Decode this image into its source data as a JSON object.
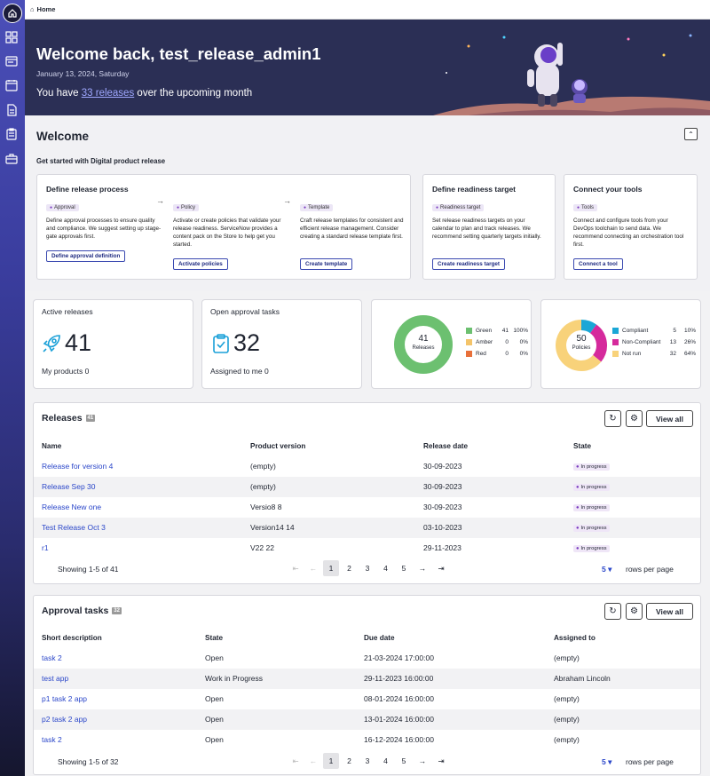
{
  "breadcrumb": {
    "home": "Home"
  },
  "hero": {
    "title": "Welcome back, test_release_admin1",
    "date": "January 13, 2024, Saturday",
    "msg_pre": "You have",
    "msg_link": "33 releases",
    "msg_post": "over the upcoming month"
  },
  "welcome": {
    "title": "Welcome",
    "subtitle": "Get started with Digital product release",
    "process": {
      "title": "Define release process",
      "steps": [
        {
          "pill": "Approval",
          "desc": "Define approval processes to ensure quality and compliance. We suggest setting up stage-gate approvals first.",
          "button": "Define approval definition"
        },
        {
          "pill": "Policy",
          "desc": "Activate or create policies that validate your release readiness. ServiceNow provides a content pack on the Store to help get you started.",
          "button": "Activate policies"
        },
        {
          "pill": "Template",
          "desc": "Craft release templates for consistent and efficient release management. Consider creating a standard release template first.",
          "button": "Create template"
        }
      ]
    },
    "readiness": {
      "title": "Define readiness target",
      "pill": "Readiness target",
      "desc": "Set release readiness targets on your calendar to plan and track releases. We recommend setting quarterly targets initially.",
      "button": "Create readiness target"
    },
    "tools": {
      "title": "Connect your tools",
      "pill": "Tools",
      "desc": "Connect and configure tools from your DevOps toolchain to send data. We recommend connecting an orchestration tool first.",
      "button": "Connect a tool"
    }
  },
  "stats": {
    "active": {
      "title": "Active releases",
      "value": "41",
      "sub": "My products 0"
    },
    "approvals": {
      "title": "Open approval tasks",
      "value": "32",
      "sub": "Assigned to me 0"
    }
  },
  "chart_data": [
    {
      "type": "pie",
      "center_value": "41",
      "center_label": "Releases",
      "categories": [
        "Green",
        "Amber",
        "Red"
      ],
      "values": [
        41,
        0,
        0
      ],
      "percents": [
        "100%",
        "0%",
        "0%"
      ],
      "colors": [
        "#6cc070",
        "#f4c46a",
        "#e8703a"
      ]
    },
    {
      "type": "pie",
      "center_value": "50",
      "center_label": "Policies",
      "categories": [
        "Compliant",
        "Non-Compliant",
        "Not run"
      ],
      "values": [
        5,
        13,
        32
      ],
      "percents": [
        "10%",
        "26%",
        "64%"
      ],
      "colors": [
        "#1aa7d6",
        "#d52a9c",
        "#f8d27a"
      ]
    }
  ],
  "releases": {
    "title": "Releases",
    "count": "41",
    "view_all": "View all",
    "columns": [
      "Name",
      "Product version",
      "Release date",
      "State"
    ],
    "rows": [
      [
        "Release for version 4",
        "(empty)",
        "30-09-2023",
        "In progress"
      ],
      [
        "Release Sep 30",
        "(empty)",
        "30-09-2023",
        "In progress"
      ],
      [
        "Release New one",
        "Versio8 8",
        "30-09-2023",
        "In progress"
      ],
      [
        "Test Release Oct 3",
        "Version14 14",
        "03-10-2023",
        "In progress"
      ],
      [
        "r1",
        "V22 22",
        "29-11-2023",
        "In progress"
      ]
    ],
    "showing": "Showing 1-5 of 41",
    "pages": [
      "1",
      "2",
      "3",
      "4",
      "5"
    ],
    "rows_per_page": "5",
    "rows_label": "rows per page"
  },
  "approvals": {
    "title": "Approval tasks",
    "count": "32",
    "view_all": "View all",
    "columns": [
      "Short description",
      "State",
      "Due date",
      "Assigned to"
    ],
    "rows": [
      [
        "task 2",
        "Open",
        "21-03-2024 17:00:00",
        "(empty)"
      ],
      [
        "test app",
        "Work in Progress",
        "29-11-2023 16:00:00",
        "Abraham Lincoln"
      ],
      [
        "p1 task 2 app",
        "Open",
        "08-01-2024 16:00:00",
        "(empty)"
      ],
      [
        "p2 task 2 app",
        "Open",
        "13-01-2024 16:00:00",
        "(empty)"
      ],
      [
        "task 2",
        "Open",
        "16-12-2024 16:00:00",
        "(empty)"
      ]
    ],
    "showing": "Showing 1-5 of 32",
    "pages": [
      "1",
      "2",
      "3",
      "4",
      "5"
    ],
    "rows_per_page": "5",
    "rows_label": "rows per page"
  }
}
